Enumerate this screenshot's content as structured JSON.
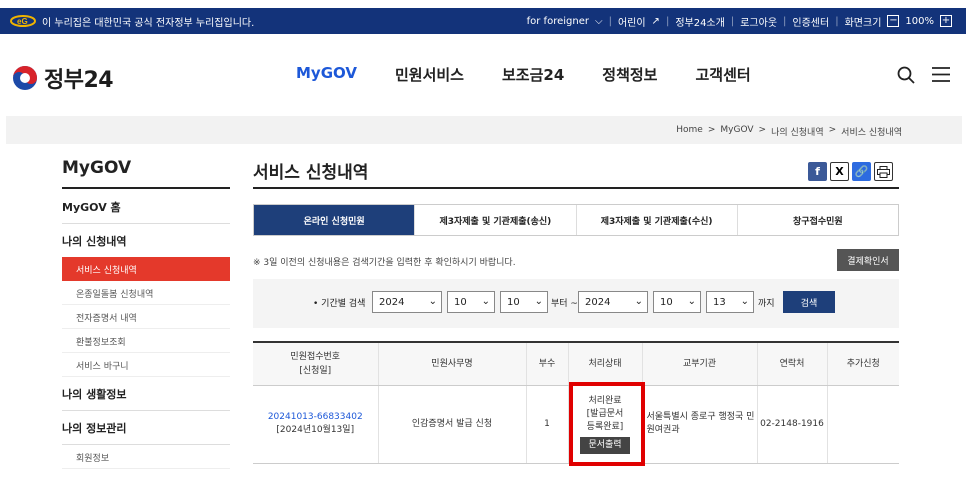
{
  "topbar": {
    "notice": "이 누리집은 대한민국 공식 전자정부 누리집입니다.",
    "foreigner": "for foreigner",
    "kids": "어린이",
    "about": "정부24소개",
    "login": "로그아웃",
    "cert": "인증센터",
    "font_size": "화면크기",
    "zoom": "100%"
  },
  "header": {
    "logo_text": "정부24",
    "nav": [
      "MyGOV",
      "민원서비스",
      "보조금24",
      "정책정보",
      "고객센터"
    ]
  },
  "breadcrumb": [
    "Home",
    "MyGOV",
    "나의 신청내역",
    "서비스 신청내역"
  ],
  "sidebar": {
    "title": "MyGOV",
    "home": "MyGOV 홈",
    "section1": "나의 신청내역",
    "items": [
      "서비스 신청내역",
      "온종일돌봄 신청내역",
      "전자증명서 내역",
      "환불정보조회",
      "서비스 바구니"
    ],
    "section2": "나의 생활정보",
    "section3": "나의 정보관리",
    "items3": [
      "회원정보"
    ]
  },
  "content": {
    "title": "서비스 신청내역",
    "tabs": [
      "온라인 신청민원",
      "제3자제출 및 기관제출(송신)",
      "제3자제출 및 기관제출(수신)",
      "창구접수민원"
    ],
    "notice": "※ 3일 이전의 신청내용은 검색기간을 입력한 후 확인하시기 바랍니다.",
    "cert_button": "결제확인서",
    "search": {
      "label": "• 기간별 검색",
      "from_year": "2024",
      "from_month": "10",
      "from_day": "10",
      "from_text": "부터 ~",
      "to_year": "2024",
      "to_month": "10",
      "to_day": "13",
      "to_text": "까지",
      "button": "검색"
    },
    "table": {
      "headers": [
        "민원접수번호",
        "[신청일]",
        "민원사무명",
        "부수",
        "처리상태",
        "교부기관",
        "연락처",
        "추가신청"
      ],
      "row": {
        "receipt_no": "20241013-66833402",
        "date": "[2024년10월13일]",
        "name": "인감증명서 발급 신청",
        "count": "1",
        "status1": "처리완료",
        "status2": "[발급문서",
        "status3": "등록완료]",
        "doc_button": "문서출력",
        "agency": "서울특별시 종로구 행정국 민원여권과",
        "phone": "02-2148-1916",
        "extra": ""
      }
    }
  },
  "colors": {
    "navy": "#13337a",
    "accent": "#1d58d8",
    "active_red": "#e4392b",
    "highlight": "#e00000"
  }
}
